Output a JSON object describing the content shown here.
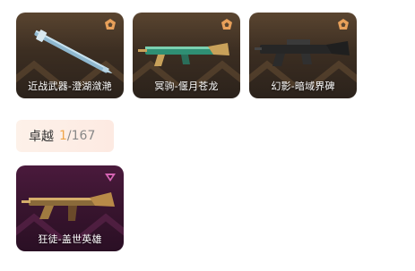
{
  "colors": {
    "premium_badge": "#e8a05a",
    "exclusive_badge": "#d764b4",
    "owned_count": "#f0a64a",
    "chip_bg": "#fdefe7"
  },
  "premium_items": [
    {
      "label": "近战武器-澄湖潋滟",
      "icon": "melee-weapon-icon",
      "badge_icon": "premium-tier-icon"
    },
    {
      "label": "冥驹-偃月苍龙",
      "icon": "rifle-icon",
      "badge_icon": "premium-tier-icon"
    },
    {
      "label": "幻影-暗域界碑",
      "icon": "rifle-icon",
      "badge_icon": "premium-tier-icon"
    }
  ],
  "tier": {
    "name": "卓越",
    "owned": "1",
    "separator": "/",
    "total": "167"
  },
  "exclusive_items": [
    {
      "label": "狂徒-盖世英雄",
      "icon": "rifle-icon",
      "badge_icon": "exclusive-tier-icon"
    }
  ]
}
